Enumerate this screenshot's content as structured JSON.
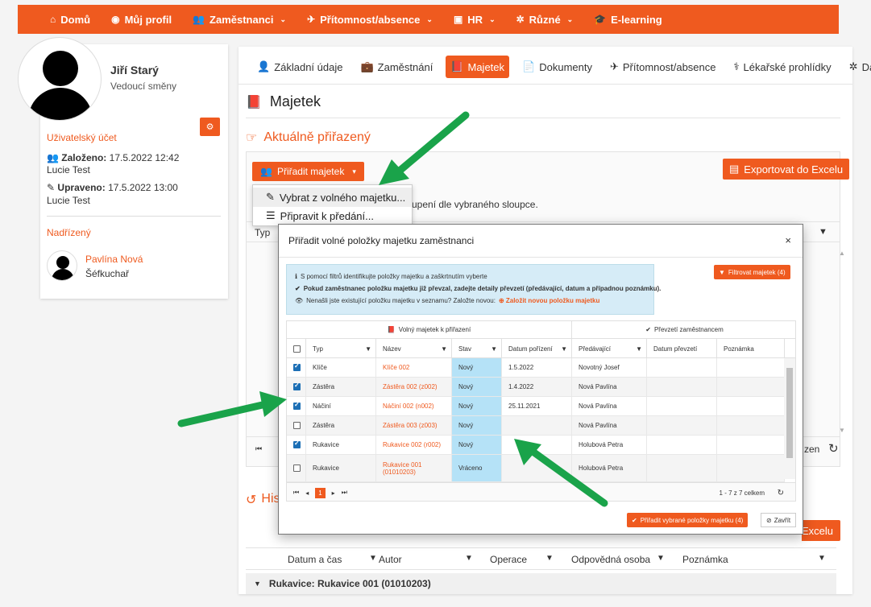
{
  "nav": [
    {
      "icon": "⌂",
      "label": "Domů",
      "chev": false
    },
    {
      "icon": "◉",
      "label": "Můj profil",
      "chev": false
    },
    {
      "icon": "👥",
      "label": "Zaměstnanci",
      "chev": true
    },
    {
      "icon": "✈",
      "label": "Přítomnost/absence",
      "chev": true
    },
    {
      "icon": "▣",
      "label": "HR",
      "chev": true
    },
    {
      "icon": "✲",
      "label": "Různé",
      "chev": true
    },
    {
      "icon": "🎓",
      "label": "E-learning",
      "chev": false
    }
  ],
  "user": {
    "name": "Jiří Starý",
    "role": "Vedoucí směny"
  },
  "account": {
    "title": "Uživatelský účet",
    "created_label": "Založeno:",
    "created_value": "17.5.2022 12:42",
    "created_by": "Lucie Test",
    "updated_label": "Upraveno:",
    "updated_value": "17.5.2022 13:00",
    "updated_by": "Lucie Test"
  },
  "supervisor": {
    "title": "Nadřízený",
    "name": "Pavlína Nová",
    "role": "Šéfkuchař"
  },
  "tabs": [
    {
      "icon": "👤",
      "label": "Základní údaje",
      "active": false
    },
    {
      "icon": "💼",
      "label": "Zaměstnání",
      "active": false
    },
    {
      "icon": "📕",
      "label": "Majetek",
      "active": true
    },
    {
      "icon": "📄",
      "label": "Dokumenty",
      "active": false
    },
    {
      "icon": "✈",
      "label": "Přítomnost/absence",
      "active": false
    },
    {
      "icon": "⚕",
      "label": "Lékařské prohlídky",
      "active": false
    },
    {
      "icon": "✲",
      "label": "Další",
      "active": false
    }
  ],
  "page_title": "Majetek",
  "current_title": "Aktuálně přiřazený",
  "assign_button": "Přiřadit majetek",
  "export_button": "Exportovat do Excelu",
  "dropdown": {
    "item1": "Vybrat z volného majetku...",
    "item2": "Připravit k předání..."
  },
  "bg_texts": {
    "group_hint": "upení dle vybraného sloupce.",
    "typ": "Typ",
    "zen": "zen"
  },
  "history": {
    "title": "His",
    "export_partial": "Excelu",
    "columns": [
      "Datum a čas",
      "Autor",
      "Operace",
      "Odpovědná osoba",
      "Poznámka"
    ],
    "group_row": "Rukavice: Rukavice 001 (01010203)"
  },
  "modal": {
    "title": "Přiřadit volné položky majetku zaměstnanci",
    "close": "×",
    "info1": "S pomocí filtrů identifikujte položky majetku a zaškrtnutím vyberte",
    "info2": "Pokud zaměstnanec položku majetku již převzal, zadejte detaily převzetí (předávající, datum a případnou poznámku).",
    "info3": "Nenašli jste existující položku majetku v seznamu? Založte novou:",
    "info3_link": "Založit novou položku majetku",
    "filter_button": "Filtrovat majetek (4)",
    "group_left": "Volný majetek k přiřazení",
    "group_right": "Převzetí zaměstnancem",
    "columns": [
      "Typ",
      "Název",
      "Stav",
      "Datum pořízení",
      "Předávající",
      "Datum převzetí",
      "Poznámka"
    ],
    "rows": [
      {
        "checked": true,
        "typ": "Klíče",
        "nazev": "Klíče 002",
        "stav": "Nový",
        "datum": "1.5.2022",
        "predavajici": "Novotný Josef"
      },
      {
        "checked": true,
        "typ": "Zástěra",
        "nazev": "Zástěra 002 (z002)",
        "stav": "Nový",
        "datum": "1.4.2022",
        "predavajici": "Nová Pavlína"
      },
      {
        "checked": true,
        "typ": "Náčiní",
        "nazev": "Náčiní 002 (n002)",
        "stav": "Nový",
        "datum": "25.11.2021",
        "predavajici": "Nová Pavlína"
      },
      {
        "checked": false,
        "typ": "Zástěra",
        "nazev": "Zástěra 003 (z003)",
        "stav": "Nový",
        "datum": "",
        "predavajici": "Nová Pavlína"
      },
      {
        "checked": true,
        "typ": "Rukavice",
        "nazev": "Rukavice 002 (r002)",
        "stav": "Nový",
        "datum": "",
        "predavajici": "Holubová Petra"
      },
      {
        "checked": false,
        "typ": "Rukavice",
        "nazev": "Rukavice 001 (01010203)",
        "stav": "Vráceno",
        "datum": "",
        "predavajici": "Holubová Petra"
      }
    ],
    "pager_page": "1",
    "pager_info": "1 - 7 z 7 celkem",
    "assign_selected": "Přiřadit vybrané položky majetku (4)",
    "close_button": "Zavřít"
  },
  "colors": {
    "accent": "#ef5a1f",
    "arrow": "#1aa34a",
    "info_bg": "#d6ecf7"
  }
}
